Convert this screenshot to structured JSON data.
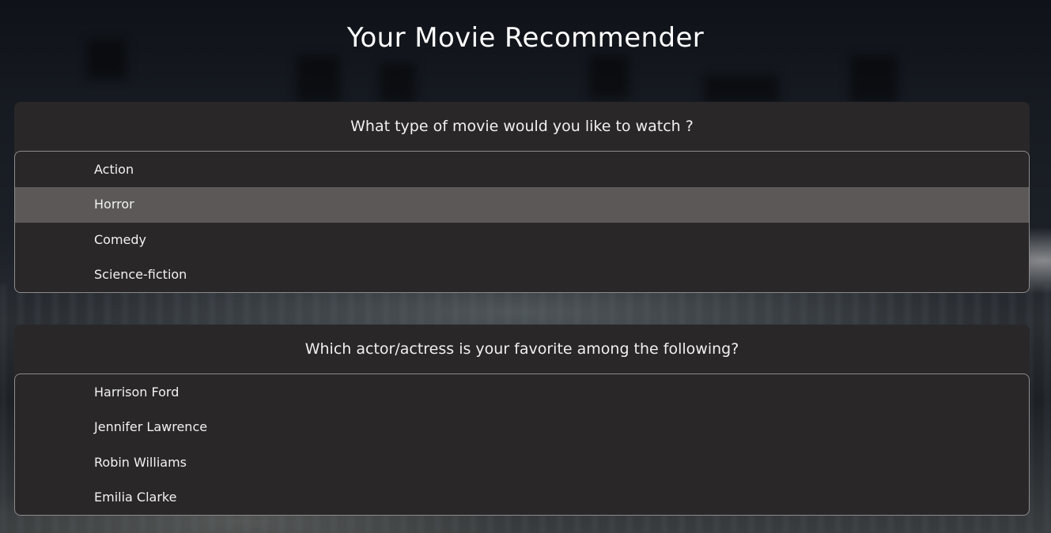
{
  "app": {
    "title": "Your Movie Recommender"
  },
  "questions": [
    {
      "text": "What type of movie would you like to watch ?",
      "options": [
        "Action",
        "Horror",
        "Comedy",
        "Science-fiction"
      ],
      "highlighted_option": "Horror"
    },
    {
      "text": "Which actor/actress is your favorite among the following?",
      "options": [
        "Harrison Ford",
        "Jennifer Lawrence",
        "Robin Williams",
        "Emilia Clarke"
      ]
    }
  ],
  "colors": {
    "card_background": "#292728",
    "option_highlight": "#5b5857",
    "border": "#8d8b8c",
    "text": "#f2f2f2"
  }
}
